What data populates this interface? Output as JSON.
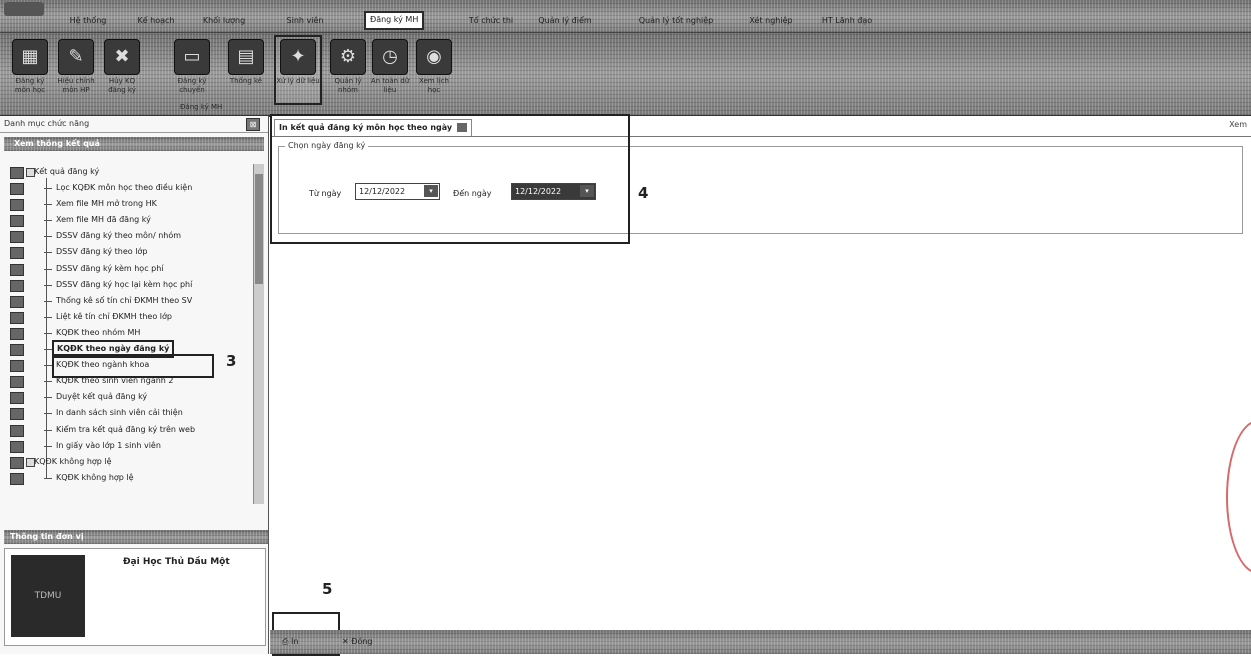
{
  "menu_tabs": [
    "Hệ thống",
    "Kế hoạch",
    "Khối lượng",
    "Sinh viên",
    "Đăng ký MH",
    "Tổ chức thi",
    "Quản lý điểm",
    "Quản lý tốt nghiệp",
    "Xét nghiệp",
    "HT Lãnh đạo"
  ],
  "ribbon": {
    "buttons": [
      "Đăng ký môn học",
      "Hiệu chỉnh môn HP",
      "Hủy KQ đăng ký",
      "Đăng ký chuyển",
      "Thống kê",
      "Xử lý dữ liệu",
      "Quản lý nhóm",
      "An toàn dữ liệu",
      "Xem lịch học"
    ],
    "group_label": "Đăng ký MH"
  },
  "left_panel": {
    "title": "Danh mục chức năng",
    "section": "Xem thông kết quả",
    "tree": [
      {
        "label": "Kết quả đăng ký",
        "parent": true
      },
      {
        "label": "Lọc KQĐK môn học theo điều kiện"
      },
      {
        "label": "Xem file MH mở trong HK"
      },
      {
        "label": "Xem file MH đã đăng ký"
      },
      {
        "label": "DSSV đăng ký theo môn/ nhóm"
      },
      {
        "label": "DSSV đăng ký theo lớp"
      },
      {
        "label": "DSSV đăng ký kèm học phí"
      },
      {
        "label": "DSSV đăng ký học lại kèm học phí"
      },
      {
        "label": "Thống kê số tín chỉ ĐKMH theo SV"
      },
      {
        "label": "Liệt kê tín chỉ ĐKMH theo lớp"
      },
      {
        "label": "KQĐK theo nhóm MH"
      },
      {
        "label": "KQĐK theo ngày đăng ký",
        "highlight": true
      },
      {
        "label": "KQĐK theo ngành khoa"
      },
      {
        "label": "KQĐK theo sinh viên ngành 2"
      },
      {
        "label": "Duyệt kết quả đăng ký"
      },
      {
        "label": "In danh sách sinh viên cải thiện"
      },
      {
        "label": "Kiểm tra kết quả đăng ký trên web"
      },
      {
        "label": "In giấy vào lớp 1 sinh viên"
      },
      {
        "label": "KQĐK không hợp lệ",
        "parent": true
      },
      {
        "label": "KQĐK không hợp lệ"
      }
    ],
    "info_title": "Thông tin đơn vị",
    "school_name": "Đại Học Thủ Dầu Một",
    "logo_text": "TDMU"
  },
  "content": {
    "tab_title": "In kết quả đăng ký môn học theo ngày",
    "group_label": "Chọn ngày đăng ký",
    "from_label": "Từ ngày",
    "from_value": "12/12/2022",
    "to_label": "Đến ngày",
    "to_value": "12/12/2022",
    "right_label": "Xem",
    "print_label": "In",
    "close_label": "Đóng"
  },
  "callouts": [
    "3",
    "4",
    "5"
  ]
}
